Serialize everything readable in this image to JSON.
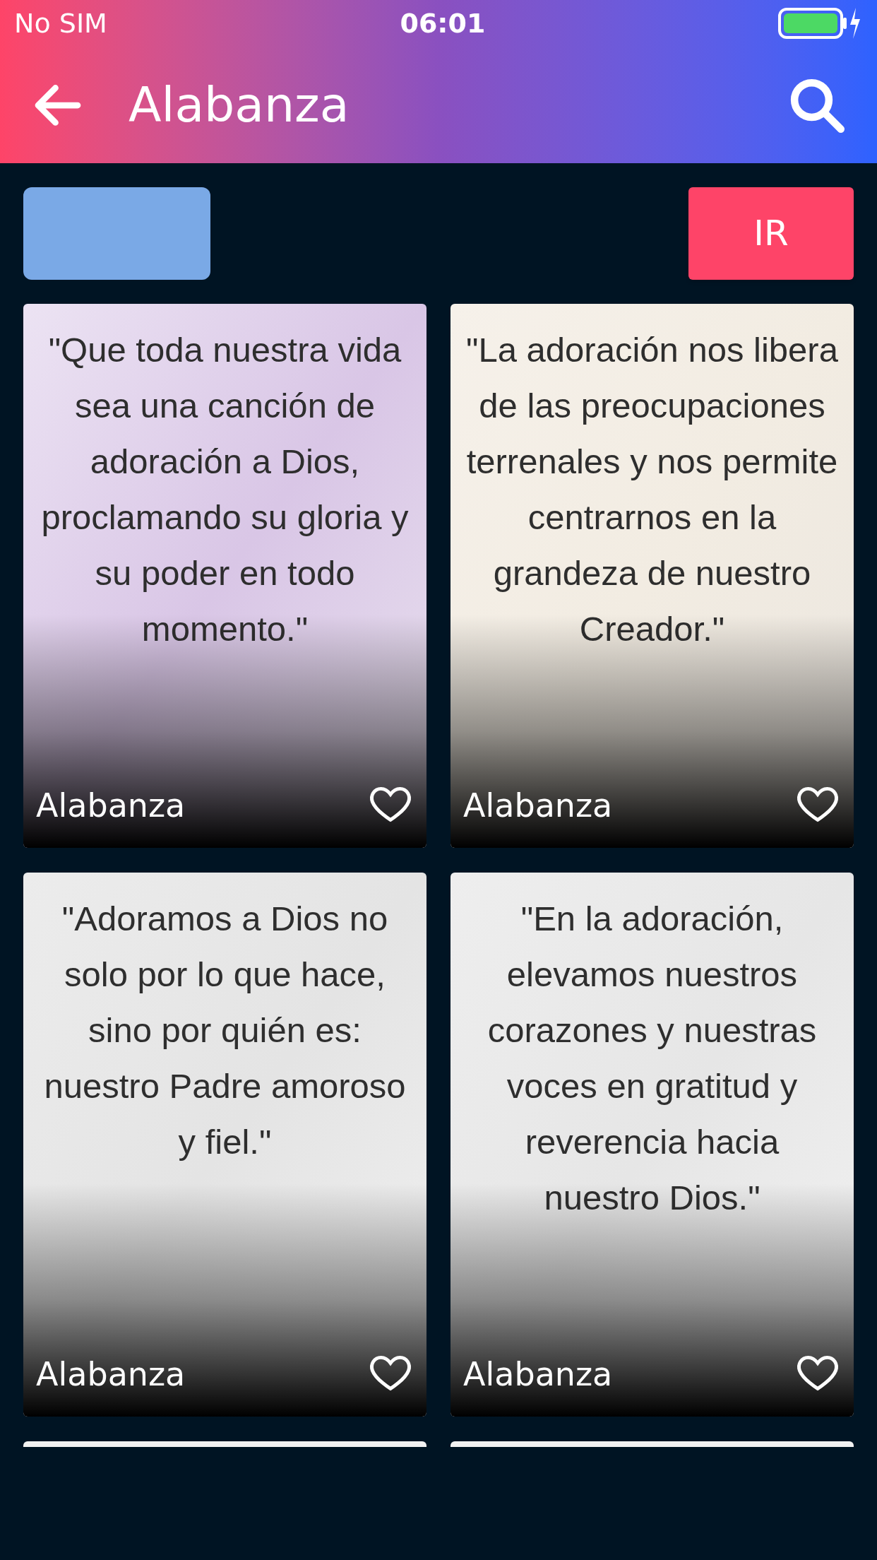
{
  "status_bar": {
    "carrier": "No SIM",
    "time": "06:01"
  },
  "header": {
    "title": "Alabanza"
  },
  "actions": {
    "go_button": "IR"
  },
  "cards": [
    {
      "quote": "\"Que toda nuestra vida sea una canción de adoración a Dios, proclamando su gloria y su poder en todo momento.\"",
      "category": "Alabanza",
      "favorite": false
    },
    {
      "quote": "\"La adoración nos libera de las preocupaciones terrenales y nos permite centrarnos en la grandeza de nuestro Creador.\"",
      "category": "Alabanza",
      "favorite": false
    },
    {
      "quote": "\"Adoramos a Dios no solo por lo que hace, sino por quién es: nuestro Padre amoroso y fiel.\"",
      "category": "Alabanza",
      "favorite": false
    },
    {
      "quote": "\"En la adoración, elevamos nuestros corazones y nuestras voces en gratitud y reverencia hacia nuestro Dios.\"",
      "category": "Alabanza",
      "favorite": false
    }
  ]
}
